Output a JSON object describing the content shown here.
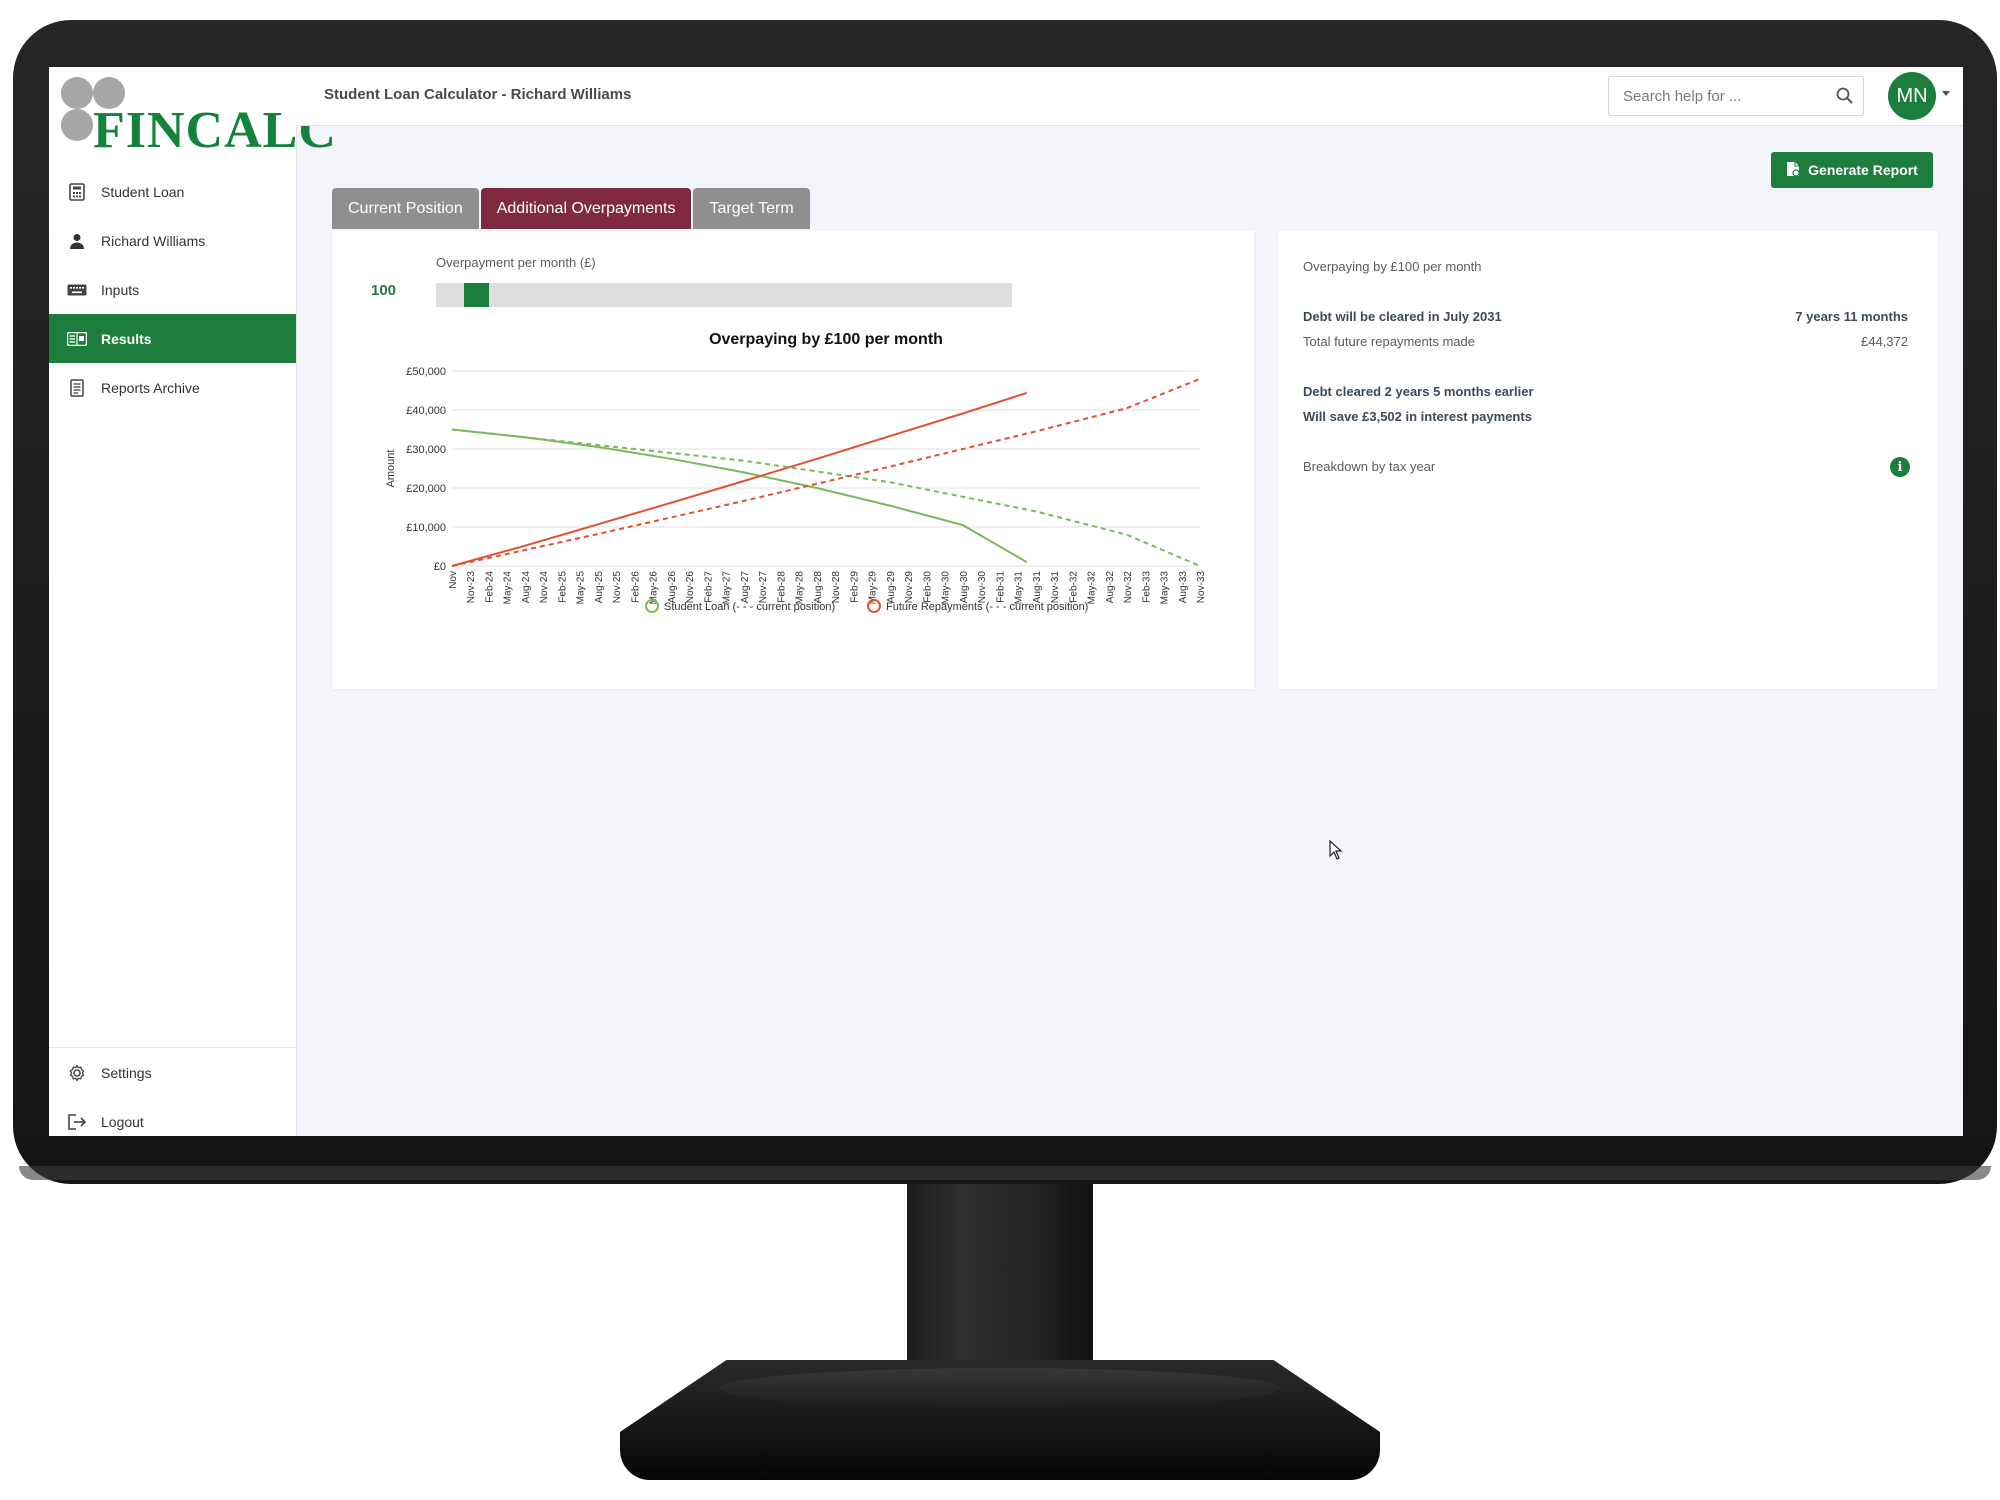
{
  "app": {
    "logo_text": "FINCALC",
    "page_title": "Student Loan Calculator - Richard Williams"
  },
  "sidebar": {
    "items": [
      {
        "label": "Student Loan",
        "icon": "calculator-icon"
      },
      {
        "label": "Richard Williams",
        "icon": "user-icon"
      },
      {
        "label": "Inputs",
        "icon": "keyboard-icon"
      },
      {
        "label": "Results",
        "icon": "results-icon",
        "active": true
      },
      {
        "label": "Reports Archive",
        "icon": "document-icon"
      }
    ],
    "bottom_items": [
      {
        "label": "Settings",
        "icon": "gear-icon"
      },
      {
        "label": "Logout",
        "icon": "logout-icon"
      }
    ]
  },
  "search": {
    "placeholder": "Search help for ..."
  },
  "user": {
    "initials": "MN"
  },
  "toolbar": {
    "generate_label": "Generate Report"
  },
  "tabs": [
    {
      "label": "Current Position",
      "active": false
    },
    {
      "label": "Additional Overpayments",
      "active": true
    },
    {
      "label": "Target Term",
      "active": false
    }
  ],
  "slider": {
    "label": "Overpayment per month (£)",
    "value": "100",
    "position_fraction": 0.05
  },
  "summary": {
    "heading": "Overpaying by £100 per month",
    "cleared_label": "Debt will be cleared in July 2031",
    "cleared_term": "7 years 11 months",
    "total_label": "Total future repayments made",
    "total_value": "£44,372",
    "earlier_text": "Debt cleared 2 years 5 months earlier",
    "save_text": "Will save £3,502 in interest payments",
    "breakdown_label": "Breakdown by tax year"
  },
  "colors": {
    "brand_green": "#1c7d3d",
    "tab_active": "#7f2a3e",
    "loan_line": "#7cb85c",
    "repay_line": "#e2502f"
  },
  "chart_data": {
    "type": "line",
    "title": "Overpaying by £100 per month",
    "ylabel": "Amount",
    "xlabel": "",
    "ylim": [
      0,
      50000
    ],
    "yticks": [
      "£0",
      "£10,000",
      "£20,000",
      "£30,000",
      "£40,000",
      "£50,000"
    ],
    "yticks_values": [
      0,
      10000,
      20000,
      30000,
      40000,
      50000
    ],
    "categories": [
      "Nov",
      "Nov-23",
      "Feb-24",
      "May-24",
      "Aug-24",
      "Nov-24",
      "Feb-25",
      "May-25",
      "Aug-25",
      "Nov-25",
      "Feb-26",
      "May-26",
      "Aug-26",
      "Nov-26",
      "Feb-27",
      "May-27",
      "Aug-27",
      "Nov-27",
      "Feb-28",
      "May-28",
      "Aug-28",
      "Nov-28",
      "Feb-29",
      "May-29",
      "Aug-29",
      "Nov-29",
      "Feb-30",
      "May-30",
      "Aug-30",
      "Nov-30",
      "Feb-31",
      "May-31",
      "Aug-31",
      "Nov-31",
      "Feb-32",
      "May-32",
      "Aug-32",
      "Nov-32",
      "Feb-33",
      "May-33",
      "Aug-33",
      "Nov-33"
    ],
    "series": [
      {
        "name": "Student Loan",
        "style": "solid",
        "color": "#7cb85c",
        "points": [
          [
            0,
            35000
          ],
          [
            4,
            33000
          ],
          [
            8,
            30500
          ],
          [
            12,
            27500
          ],
          [
            16,
            24000
          ],
          [
            20,
            20000
          ],
          [
            24,
            15500
          ],
          [
            28,
            10500
          ],
          [
            31.5,
            1000
          ]
        ]
      },
      {
        "name": "Future Repayments",
        "style": "solid",
        "color": "#e2502f",
        "points": [
          [
            0,
            0
          ],
          [
            4,
            5200
          ],
          [
            8,
            10700
          ],
          [
            12,
            16200
          ],
          [
            16,
            21800
          ],
          [
            20,
            27500
          ],
          [
            24,
            33300
          ],
          [
            28,
            39100
          ],
          [
            31.5,
            44372
          ]
        ]
      },
      {
        "name": "Student Loan current position",
        "style": "dashed",
        "color": "#7cb85c",
        "points": [
          [
            0,
            35000
          ],
          [
            8,
            31000
          ],
          [
            16,
            27000
          ],
          [
            24,
            21500
          ],
          [
            32,
            14000
          ],
          [
            37,
            8000
          ],
          [
            41,
            0
          ]
        ]
      },
      {
        "name": "Future Repayments current position",
        "style": "dashed",
        "color": "#e2502f",
        "points": [
          [
            0,
            0
          ],
          [
            8,
            8200
          ],
          [
            16,
            16700
          ],
          [
            24,
            25500
          ],
          [
            32,
            34500
          ],
          [
            37,
            40500
          ],
          [
            41,
            48000
          ]
        ]
      }
    ],
    "legend": [
      {
        "label": "Student Loan (- - - current position)",
        "color": "#7cb85c"
      },
      {
        "label": "Future Repayments (- - - current position)",
        "color": "#e2502f"
      }
    ],
    "legend_position": "bottom",
    "grid": true
  }
}
